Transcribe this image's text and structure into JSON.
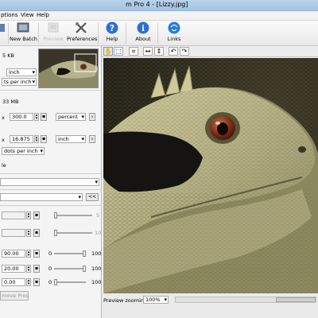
{
  "window": {
    "title": "m Pro 4 - [Lizzy.jpg]"
  },
  "menu": [
    "ptions",
    "View",
    "Help"
  ],
  "toolbar": {
    "new_batch": "New Batch",
    "preview": "Preview",
    "preferences": "Preferences",
    "help": "Help",
    "about": "About",
    "links": "Links"
  },
  "panel": {
    "orig_size": "5 KB",
    "orig_unit": "inch",
    "orig_res_unit": "ts per inch",
    "new_size": "33 MB",
    "width_value": "300.0",
    "width_unit": "percent",
    "height_value": "16.875",
    "height_unit": "inch",
    "resolution_unit": "dots per inch",
    "cut_label": "le",
    "combo1": "",
    "combo2": "",
    "collapse_btn": "<<",
    "sliders": [
      {
        "value": 0,
        "max": "5",
        "field": ""
      },
      {
        "value": 0,
        "max": "10",
        "field": ""
      },
      {
        "min": "0",
        "value": 100,
        "max": "100",
        "field": "90.00"
      },
      {
        "min": "0",
        "value": 100,
        "max": "100",
        "field": "20.00"
      },
      {
        "min": "0",
        "value": 0,
        "max": "100",
        "field": "0.00"
      }
    ],
    "remove_preset": "move Preset"
  },
  "preview": {
    "zoom_label": "Preview zooming:",
    "zoom_value": "100%"
  }
}
